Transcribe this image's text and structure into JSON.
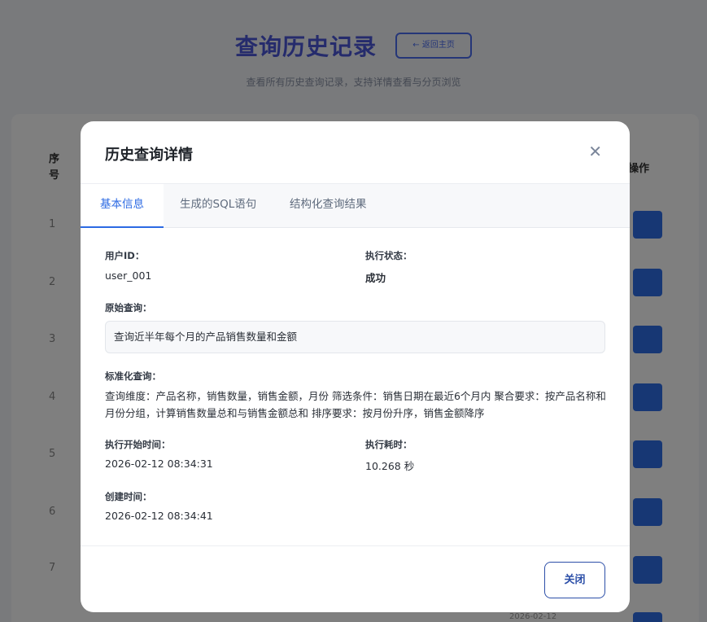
{
  "background": {
    "title": "查询历史记录",
    "back_label": "← 返回主页",
    "subtitle": "查看所有历史查询记录，支持详情查看与分页浏览",
    "header_index": "序号",
    "header_action": "操作",
    "rows": [
      "1",
      "2",
      "3",
      "4",
      "5",
      "6",
      "7"
    ],
    "date_fragment": "2026-02-12"
  },
  "modal": {
    "title": "历史查询详情",
    "close_icon": "close-icon",
    "tabs": [
      {
        "label": "基本信息",
        "active": true
      },
      {
        "label": "生成的SQL语句",
        "active": false
      },
      {
        "label": "结构化查询结果",
        "active": false
      }
    ],
    "fields": {
      "user_id_label": "用户ID：",
      "user_id_value": "user_001",
      "status_label": "执行状态：",
      "status_value": "成功",
      "original_query_label": "原始查询：",
      "original_query_value": "查询近半年每个月的产品销售数量和金额",
      "normalized_query_label": "标准化查询：",
      "normalized_query_value": "查询维度：产品名称，销售数量，销售金额，月份 筛选条件：销售日期在最近6个月内 聚合要求：按产品名称和月份分组，计算销售数量总和与销售金额总和 排序要求：按月份升序，销售金额降序",
      "start_time_label": "执行开始时间：",
      "start_time_value": "2026-02-12 08:34:31",
      "duration_label": "执行耗时：",
      "duration_value": "10.268 秒",
      "created_label": "创建时间：",
      "created_value": "2026-02-12 08:34:41"
    },
    "footer": {
      "close_label": "关闭"
    }
  },
  "colors": {
    "accent": "#2c6ae3",
    "overlay": "rgba(0,0,0,0.5)",
    "button_border": "#2c4fa8"
  }
}
